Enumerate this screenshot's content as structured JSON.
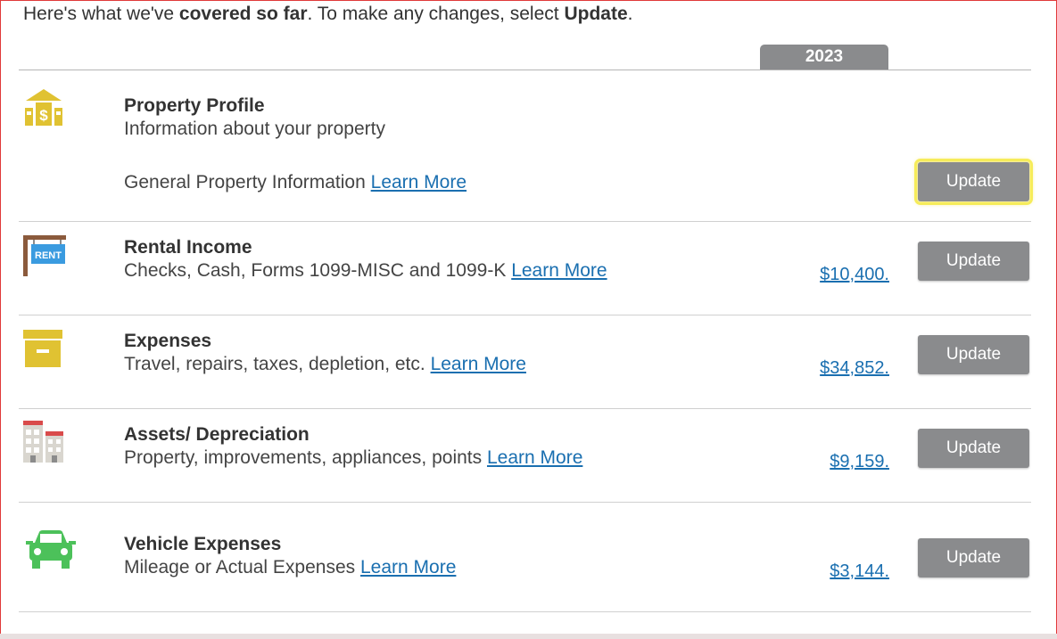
{
  "intro": {
    "prefix": "Here's what we've ",
    "bold1": "covered so far",
    "middle": ". To make any changes, select ",
    "bold2": "Update",
    "suffix": "."
  },
  "year_tab": "2023",
  "rows": [
    {
      "title": "Property Profile",
      "subtitle": "Information about your property",
      "detail": "General Property Information",
      "learn_more": "Learn More",
      "amount": "",
      "button": "Update",
      "icon": "property-money-icon"
    },
    {
      "title": "Rental Income",
      "subtitle": "Checks, Cash, Forms 1099-MISC and 1099-K",
      "learn_more": "Learn More",
      "amount": "$10,400.",
      "button": "Update",
      "icon": "rent-sign-icon",
      "icon_text": "RENT"
    },
    {
      "title": "Expenses",
      "subtitle": "Travel, repairs, taxes, depletion, etc.",
      "learn_more": "Learn More",
      "amount": "$34,852.",
      "button": "Update",
      "icon": "file-box-icon"
    },
    {
      "title": "Assets/ Depreciation",
      "subtitle": "Property, improvements, appliances, points",
      "learn_more": "Learn More",
      "amount": "$9,159.",
      "button": "Update",
      "icon": "buildings-icon"
    },
    {
      "title": "Vehicle Expenses",
      "subtitle": "Mileage or Actual Expenses",
      "learn_more": "Learn More",
      "amount": "$3,144.",
      "button": "Update",
      "icon": "car-icon"
    }
  ],
  "colors": {
    "link": "#1a6fb0",
    "button": "#8a8b8d",
    "focus": "#f6ec5a",
    "icon_yellow": "#e0c232",
    "icon_green": "#4cc15a",
    "icon_red": "#d94b4b"
  }
}
